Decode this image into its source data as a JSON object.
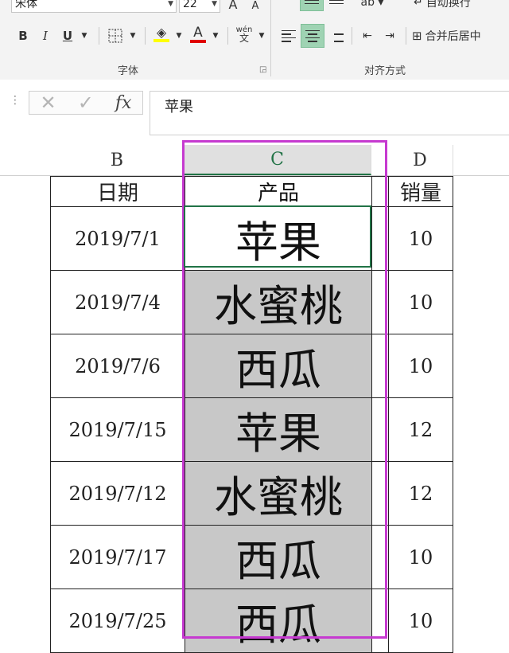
{
  "ribbon": {
    "font_name": "宋体",
    "font_size": "22",
    "grow_font": "A",
    "shrink_font": "A",
    "bold": "B",
    "italic": "I",
    "underline": "U",
    "phonetic_top": "wén",
    "phonetic_bottom": "文",
    "wrap_text": "自动换行",
    "merge_center": "合并后居中",
    "group_font": "字体",
    "group_alignment": "对齐方式"
  },
  "formula_bar": {
    "cancel_symbol": "✕",
    "enter_symbol": "✓",
    "fx_label": "fx",
    "content": "苹果"
  },
  "columns": {
    "b": "B",
    "c": "C",
    "d": "D"
  },
  "table": {
    "headers": [
      "日期",
      "产品",
      "销量"
    ],
    "rows": [
      [
        "2019/7/1",
        "苹果",
        "10"
      ],
      [
        "2019/7/4",
        "水蜜桃",
        "10"
      ],
      [
        "2019/7/6",
        "西瓜",
        "10"
      ],
      [
        "2019/7/15",
        "苹果",
        "12"
      ],
      [
        "2019/7/12",
        "水蜜桃",
        "12"
      ],
      [
        "2019/7/17",
        "西瓜",
        "10"
      ],
      [
        "2019/7/25",
        "西瓜",
        "10"
      ]
    ]
  },
  "colors": {
    "selection_highlight": "#c63ad0",
    "excel_green": "#217346",
    "selected_fill": "#c8c8c8"
  }
}
